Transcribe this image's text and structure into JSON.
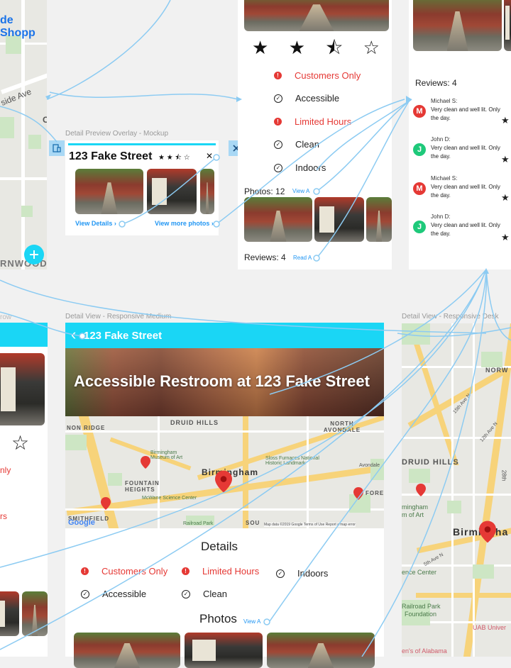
{
  "left_map": {
    "title_fragment": "de Shopp",
    "street_label": "side Ave",
    "area_label": "RNWOOD",
    "letter_c": "C",
    "fab_icon": "plus-icon"
  },
  "preview_overlay": {
    "caption": "Detail Preview Overlay - Mockup",
    "address": "123 Fake Street",
    "rating_stars": "★ ★ ⯪ ☆",
    "rating_value": 2.5,
    "close_glyph": "✕",
    "view_details": "View Details",
    "view_more_photos": "View more photos",
    "chevron": "›"
  },
  "detail_small": {
    "stars": [
      "★",
      "★",
      "⯪",
      "☆"
    ],
    "features": [
      {
        "label": "Customers Only",
        "kind": "alert"
      },
      {
        "label": "Accessible",
        "kind": "check"
      },
      {
        "label": "Limited Hours",
        "kind": "alert"
      },
      {
        "label": "Clean",
        "kind": "check"
      },
      {
        "label": "Indoors",
        "kind": "check"
      }
    ],
    "photos_label": "Photos: 12",
    "photos_link": "View A",
    "reviews_label": "Reviews: 4",
    "reviews_link": "Read A"
  },
  "reviews_panel": {
    "title": "Reviews: 4",
    "reviews": [
      {
        "initial": "M",
        "name": "Michael S:",
        "text1": "Very clean and well lit. Only",
        "text2": "the day.",
        "color": "#e53935"
      },
      {
        "initial": "J",
        "name": "John D:",
        "text1": "Very clean and well lit. Only",
        "text2": "the day.",
        "color": "#1ec97a"
      },
      {
        "initial": "M",
        "name": "Michael S:",
        "text1": "Very clean and well lit. Only",
        "text2": "the day.",
        "color": "#e53935"
      },
      {
        "initial": "J",
        "name": "John D:",
        "text1": "Very clean and well lit. Only",
        "text2": "the day.",
        "color": "#1ec97a"
      }
    ],
    "star": "★"
  },
  "left_fragment": {
    "caption": "row",
    "star": "☆",
    "text1": "nly",
    "text2": "rs"
  },
  "detail_medium": {
    "caption": "Detail View - Responsive Medium",
    "back_glyph": "‹",
    "header_title": "123 Fake Street",
    "hero_title": "Accessible Restroom at 123 Fake Street",
    "map_labels": [
      "DRUID HILLS",
      "NON RIDGE",
      "NORTH AVONDALE",
      "Birmingham",
      "FOUNTAIN HEIGHTS",
      "SMITHFIELD",
      "Birmingham Museum of Art",
      "Sloss Furnaces National Historic Landmark",
      "McWane Science Center",
      "Railroad Park",
      "Avondale",
      "FORE",
      "SOU"
    ],
    "map_footer": "Map data ©2019 Google   Terms of Use   Report a map error",
    "google": "Google",
    "details_heading": "Details",
    "features": [
      {
        "label": "Customers Only",
        "kind": "alert"
      },
      {
        "label": "Limited Hours",
        "kind": "alert"
      },
      {
        "label": "Indoors",
        "kind": "check"
      },
      {
        "label": "Accessible",
        "kind": "check"
      },
      {
        "label": "Clean",
        "kind": "check"
      }
    ],
    "photos_heading": "Photos",
    "photos_link": "View A"
  },
  "detail_desktop": {
    "caption": "Detail View - Responsive Desk",
    "map_labels": [
      "NORW",
      "DRUID HILLS",
      "Birmingha",
      "mingham",
      "m of Art",
      "ence Center",
      "Railroad Park",
      "Foundation",
      "UAB Univer",
      "en's of Alabama",
      "15th Ave N",
      "12th Ave N",
      "5th Ave N",
      "28th"
    ]
  },
  "colors": {
    "accent": "#1ad6f5",
    "alert": "#e53935",
    "link": "#2196f3"
  }
}
